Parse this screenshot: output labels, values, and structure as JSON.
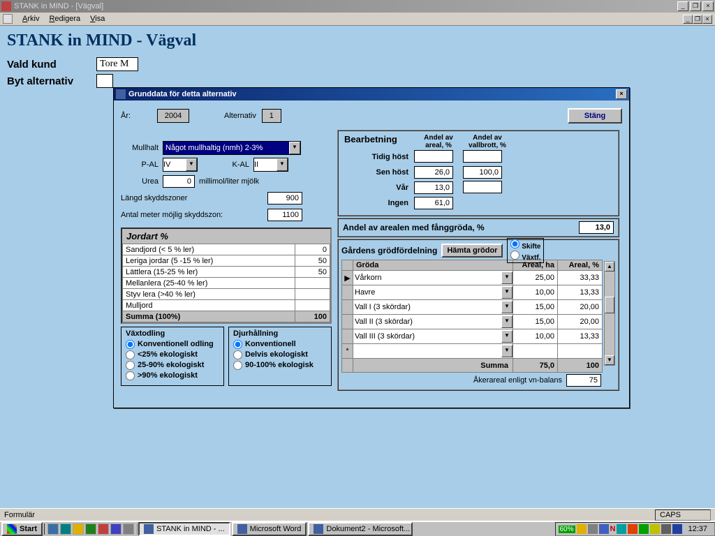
{
  "titlebar": {
    "title": "STANK in MIND - [Vägval]"
  },
  "menubar": {
    "arkiv": "Arkiv",
    "redigera": "Redigera",
    "visa": "Visa"
  },
  "page": {
    "title": "STANK in MIND - Vägval",
    "vald_kund_label": "Vald kund",
    "vald_kund_value": "Tore M",
    "byt_label": "Byt alternativ",
    "byt_value": ""
  },
  "dialog": {
    "title": "Grunddata för detta alternativ",
    "ar_label": "År:",
    "ar_value": "2004",
    "alt_label": "Alternativ",
    "alt_value": "1",
    "close_btn": "Stäng",
    "mullhalt_label": "Mullhalt",
    "mullhalt_value": "Något mullhaltig (nmh) 2-3%",
    "pal_label": "P-AL",
    "pal_value": "IV",
    "kal_label": "K-AL",
    "kal_value": "II",
    "urea_label": "Urea",
    "urea_value": "0",
    "urea_unit": "millimol/liter mjölk",
    "skydd_label": "Längd skyddszoner",
    "skydd_value": "900",
    "mojlig_label": "Antal meter möjlig skyddszon:",
    "mojlig_value": "1100"
  },
  "jordart": {
    "header": "Jordart %",
    "rows": [
      {
        "name": "Sandjord (< 5 % ler)",
        "val": "0"
      },
      {
        "name": "Leriga jordar (5 -15 % ler)",
        "val": "50"
      },
      {
        "name": "Lättlera (15-25 % ler)",
        "val": "50"
      },
      {
        "name": "Mellanlera (25-40 % ler)",
        "val": ""
      },
      {
        "name": "Styv lera (>40 % ler)",
        "val": ""
      },
      {
        "name": "Mulljord",
        "val": ""
      }
    ],
    "sum_label": "Summa (100%)",
    "sum_val": "100"
  },
  "vaxt": {
    "title": "Växtodling",
    "opts": [
      "Konventionell odling",
      "<25% ekologiskt",
      "25-90% ekologiskt",
      ">90% ekologiskt"
    ]
  },
  "djur": {
    "title": "Djurhållning",
    "opts": [
      "Konventionell",
      "Delvis ekologiskt",
      "90-100% ekologisk"
    ]
  },
  "bearb": {
    "title": "Bearbetning",
    "col1": "Andel av areal, %",
    "col2": "Andel av vallbrott, %",
    "rows": [
      {
        "label": "Tidig höst",
        "a": "",
        "b": ""
      },
      {
        "label": "Sen höst",
        "a": "26,0",
        "b": "100,0"
      },
      {
        "label": "Vår",
        "a": "13,0",
        "b": ""
      },
      {
        "label": "Ingen",
        "a": "61,0",
        "b": null
      }
    ]
  },
  "fang": {
    "label": "Andel av arealen med fånggröda, %",
    "value": "13,0"
  },
  "crops": {
    "title": "Gårdens grödfördelning",
    "fetch_btn": "Hämta grödor",
    "skifte": "Skifte",
    "vaxtf": "Växtf.",
    "cols": {
      "groda": "Gröda",
      "areal": "Areal, ha",
      "pct": "Areal, %"
    },
    "rows": [
      {
        "name": "Vårkorn",
        "ha": "25,00",
        "pct": "33,33"
      },
      {
        "name": "Havre",
        "ha": "10,00",
        "pct": "13,33"
      },
      {
        "name": "Vall I (3 skördar)",
        "ha": "15,00",
        "pct": "20,00"
      },
      {
        "name": "Vall II (3 skördar)",
        "ha": "15,00",
        "pct": "20,00"
      },
      {
        "name": "Vall III (3 skördar)",
        "ha": "10,00",
        "pct": "13,33"
      }
    ],
    "sum_label": "Summa",
    "sum_ha": "75,0",
    "sum_pct": "100",
    "aker_label": "Åkerareal enligt vn-balans",
    "aker_val": "75"
  },
  "statusbar": {
    "left": "Formulär",
    "caps": "CAPS"
  },
  "taskbar": {
    "start": "Start",
    "items": [
      {
        "label": "STANK in MIND - ...",
        "active": true
      },
      {
        "label": "Microsoft Word",
        "active": false
      },
      {
        "label": "Dokument2 - Microsoft...",
        "active": false
      }
    ],
    "pct": "60%",
    "clock": "12:37"
  }
}
